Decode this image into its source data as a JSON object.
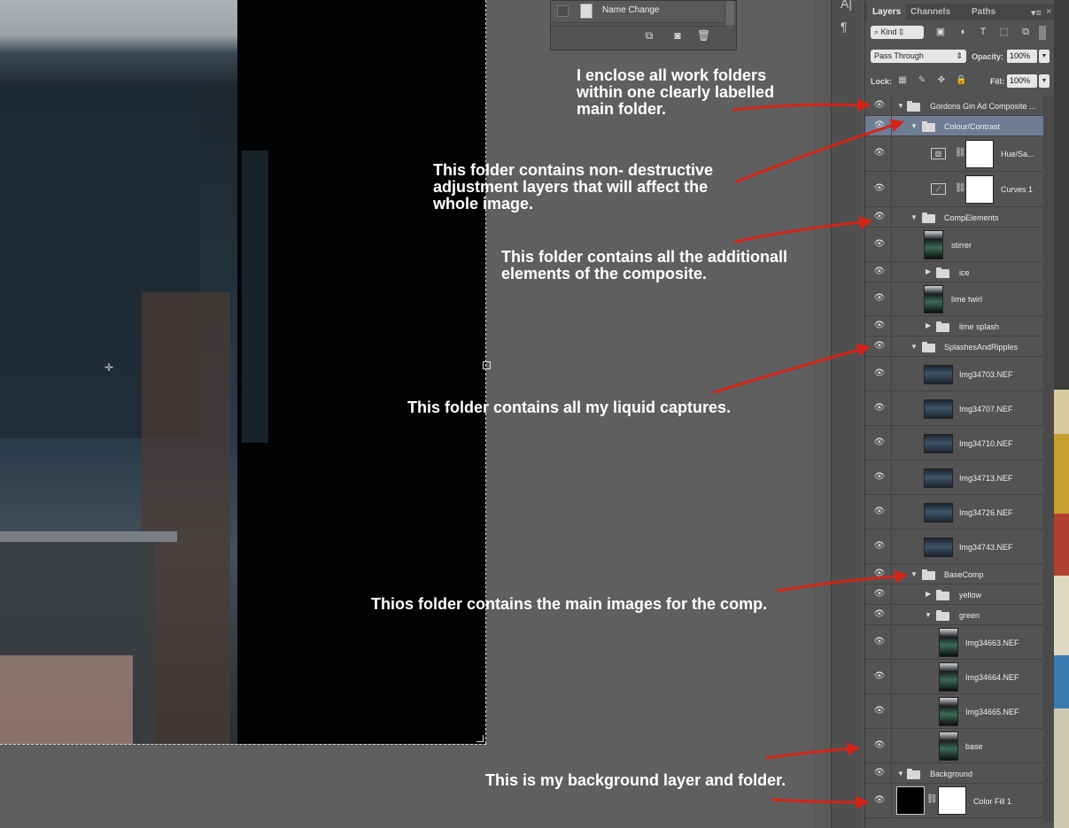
{
  "history_panel": {
    "items": [
      {
        "label": "Name Change"
      }
    ]
  },
  "layers_panel": {
    "tabs": [
      "Layers",
      "Channels",
      "Paths"
    ],
    "active_tab": "Layers",
    "filter_kind": "Kind",
    "blend_mode": "Pass Through",
    "opacity_label": "Opacity:",
    "opacity_value": "100%",
    "lock_label": "Lock:",
    "fill_label": "Fill:",
    "fill_value": "100%",
    "layers": [
      {
        "name": "Gordons Gin Ad Composite ...",
        "kind": "folder",
        "expanded": true
      },
      {
        "name": "Colour/Contrast",
        "kind": "folder",
        "expanded": true,
        "selected": true
      },
      {
        "name": "Hue/Sa...",
        "kind": "adjustment"
      },
      {
        "name": "Curves 1",
        "kind": "adjustment"
      },
      {
        "name": "CompElements",
        "kind": "folder",
        "expanded": true
      },
      {
        "name": "stirrer",
        "kind": "image"
      },
      {
        "name": "ice",
        "kind": "folder",
        "expanded": false
      },
      {
        "name": "lime twirl",
        "kind": "image"
      },
      {
        "name": "lime splash",
        "kind": "folder",
        "expanded": false
      },
      {
        "name": "SplashesAndRipples",
        "kind": "folder",
        "expanded": true
      },
      {
        "name": "Img34703.NEF",
        "kind": "image"
      },
      {
        "name": "Img34707.NEF",
        "kind": "image"
      },
      {
        "name": "Img34710.NEF",
        "kind": "image"
      },
      {
        "name": "Img34713.NEF",
        "kind": "image"
      },
      {
        "name": "Img34726.NEF",
        "kind": "image"
      },
      {
        "name": "Img34743.NEF",
        "kind": "image"
      },
      {
        "name": "BaseComp",
        "kind": "folder",
        "expanded": true
      },
      {
        "name": "yellow",
        "kind": "folder",
        "expanded": false
      },
      {
        "name": "green",
        "kind": "folder",
        "expanded": true
      },
      {
        "name": "Img34663.NEF",
        "kind": "image"
      },
      {
        "name": "Img34664.NEF",
        "kind": "image"
      },
      {
        "name": "Img34665.NEF",
        "kind": "image"
      },
      {
        "name": "base",
        "kind": "image"
      },
      {
        "name": "Background",
        "kind": "folder",
        "expanded": true
      },
      {
        "name": "Color Fill 1",
        "kind": "fill"
      }
    ]
  },
  "annotations": [
    {
      "lines": [
        "I enclose all work folders",
        "within one clearly labelled",
        "main folder."
      ]
    },
    {
      "lines": [
        "This folder contains non- destructive",
        "adjustment layers that will affect the",
        "whole image."
      ]
    },
    {
      "lines": [
        "This folder contains all the additionall",
        "elements of the composite."
      ]
    },
    {
      "lines": [
        "This folder contains all my liquid captures."
      ]
    },
    {
      "lines": [
        "Thios folder contains the main images for the comp."
      ]
    },
    {
      "lines": [
        "This is my background layer and folder."
      ]
    }
  ],
  "colors": {
    "arrow": "#d42418",
    "selected_row": "#6f7d94",
    "panel_bg": "#535353"
  }
}
